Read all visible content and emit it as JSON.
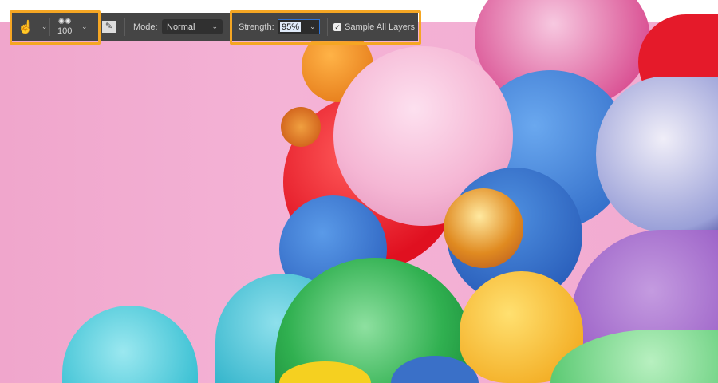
{
  "options_bar": {
    "tool_icon": "smudge-finger-icon",
    "brush_size": "100",
    "mode_label": "Mode:",
    "mode_value": "Normal",
    "strength_label": "Strength:",
    "strength_value": "95%",
    "sample_all_layers_label": "Sample All Layers",
    "sample_all_layers_checked": true
  },
  "colors": {
    "highlight": "#f5a623",
    "bar": "#454545",
    "background": "#f2abd0"
  }
}
